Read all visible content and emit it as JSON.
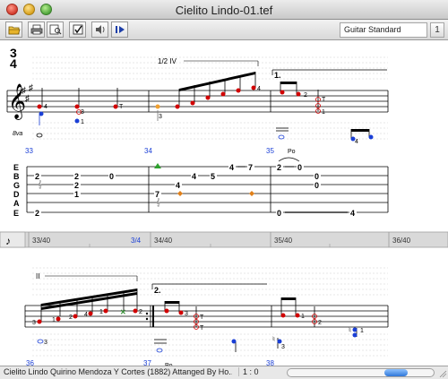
{
  "window": {
    "title": "Cielito Lindo-01.tef"
  },
  "toolbar": {
    "icons": [
      "open-folder-icon",
      "print-icon",
      "print-preview-icon",
      "checkbox-icon",
      "speaker-icon",
      "play-icon"
    ],
    "tuning": "Guitar Standard",
    "toggle_label": "1"
  },
  "score": {
    "time_sig_top": "3",
    "time_sig_bottom": "4",
    "barre_marking": "1/2 IV",
    "ending_1": "1.",
    "ending_2": "2.",
    "octave_marking": "8va",
    "string_names": [
      "E",
      "B",
      "G",
      "D",
      "A",
      "E"
    ],
    "system1": {
      "measures": [
        "33",
        "34",
        "35"
      ],
      "pull_off": "Po",
      "fingerings": [
        "4",
        "3",
        "1",
        "T",
        "3",
        "2",
        "4",
        "2",
        "T",
        "1",
        "T",
        "1",
        "4"
      ],
      "tab": {
        "m33": [
          "2",
          "2",
          "1",
          "2",
          "0",
          "2"
        ],
        "m34": [
          "7",
          "4",
          "5",
          "4",
          "7",
          "2"
        ],
        "m35": [
          "2",
          "0",
          "0",
          "0",
          "0",
          "4"
        ]
      }
    },
    "system2": {
      "measures": [
        "36",
        "37",
        "38"
      ],
      "barre_marking": "II",
      "pull_off": "Po",
      "fingerings": [
        "3",
        "1",
        "2",
        "4",
        "1",
        "3",
        "1",
        "2",
        "3",
        "3",
        "1",
        "1",
        "2",
        "T",
        "T"
      ]
    },
    "timeline": {
      "positions": [
        "33/40",
        "3/4",
        "34/40",
        "35/40",
        "36/40"
      ]
    }
  },
  "status": {
    "song_info": "Cielito Lindo  Quirino Mendoza Y Cortes (1882) Attanged By Ho...",
    "position": "1 : 0"
  }
}
